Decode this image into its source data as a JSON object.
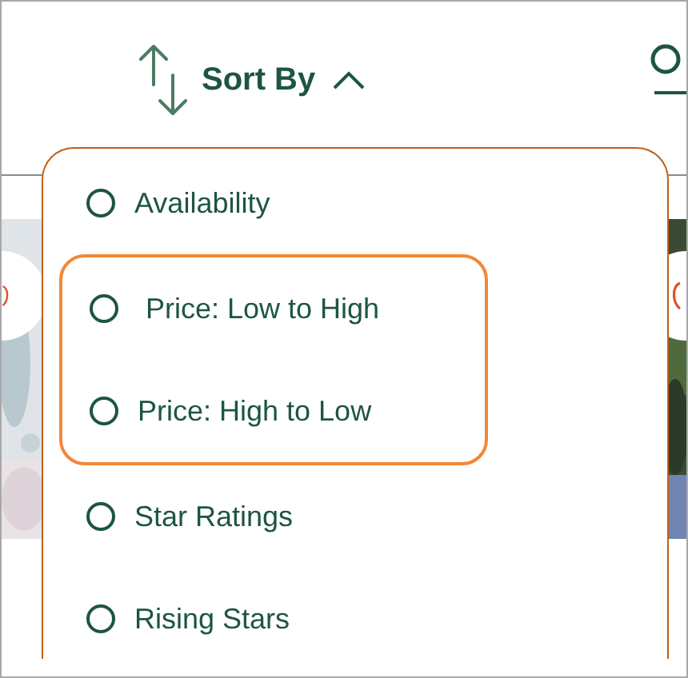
{
  "sort_button": {
    "label": "Sort By",
    "expanded": true
  },
  "sort_menu": {
    "options": [
      {
        "label": "Availability",
        "selected": false,
        "highlighted": false
      },
      {
        "label": " Price: Low to High",
        "selected": false,
        "highlighted": true
      },
      {
        "label": "Price: High to Low",
        "selected": false,
        "highlighted": true
      },
      {
        "label": "Star Ratings",
        "selected": false,
        "highlighted": false
      },
      {
        "label": "Rising Stars",
        "selected": false,
        "highlighted": false
      }
    ]
  }
}
